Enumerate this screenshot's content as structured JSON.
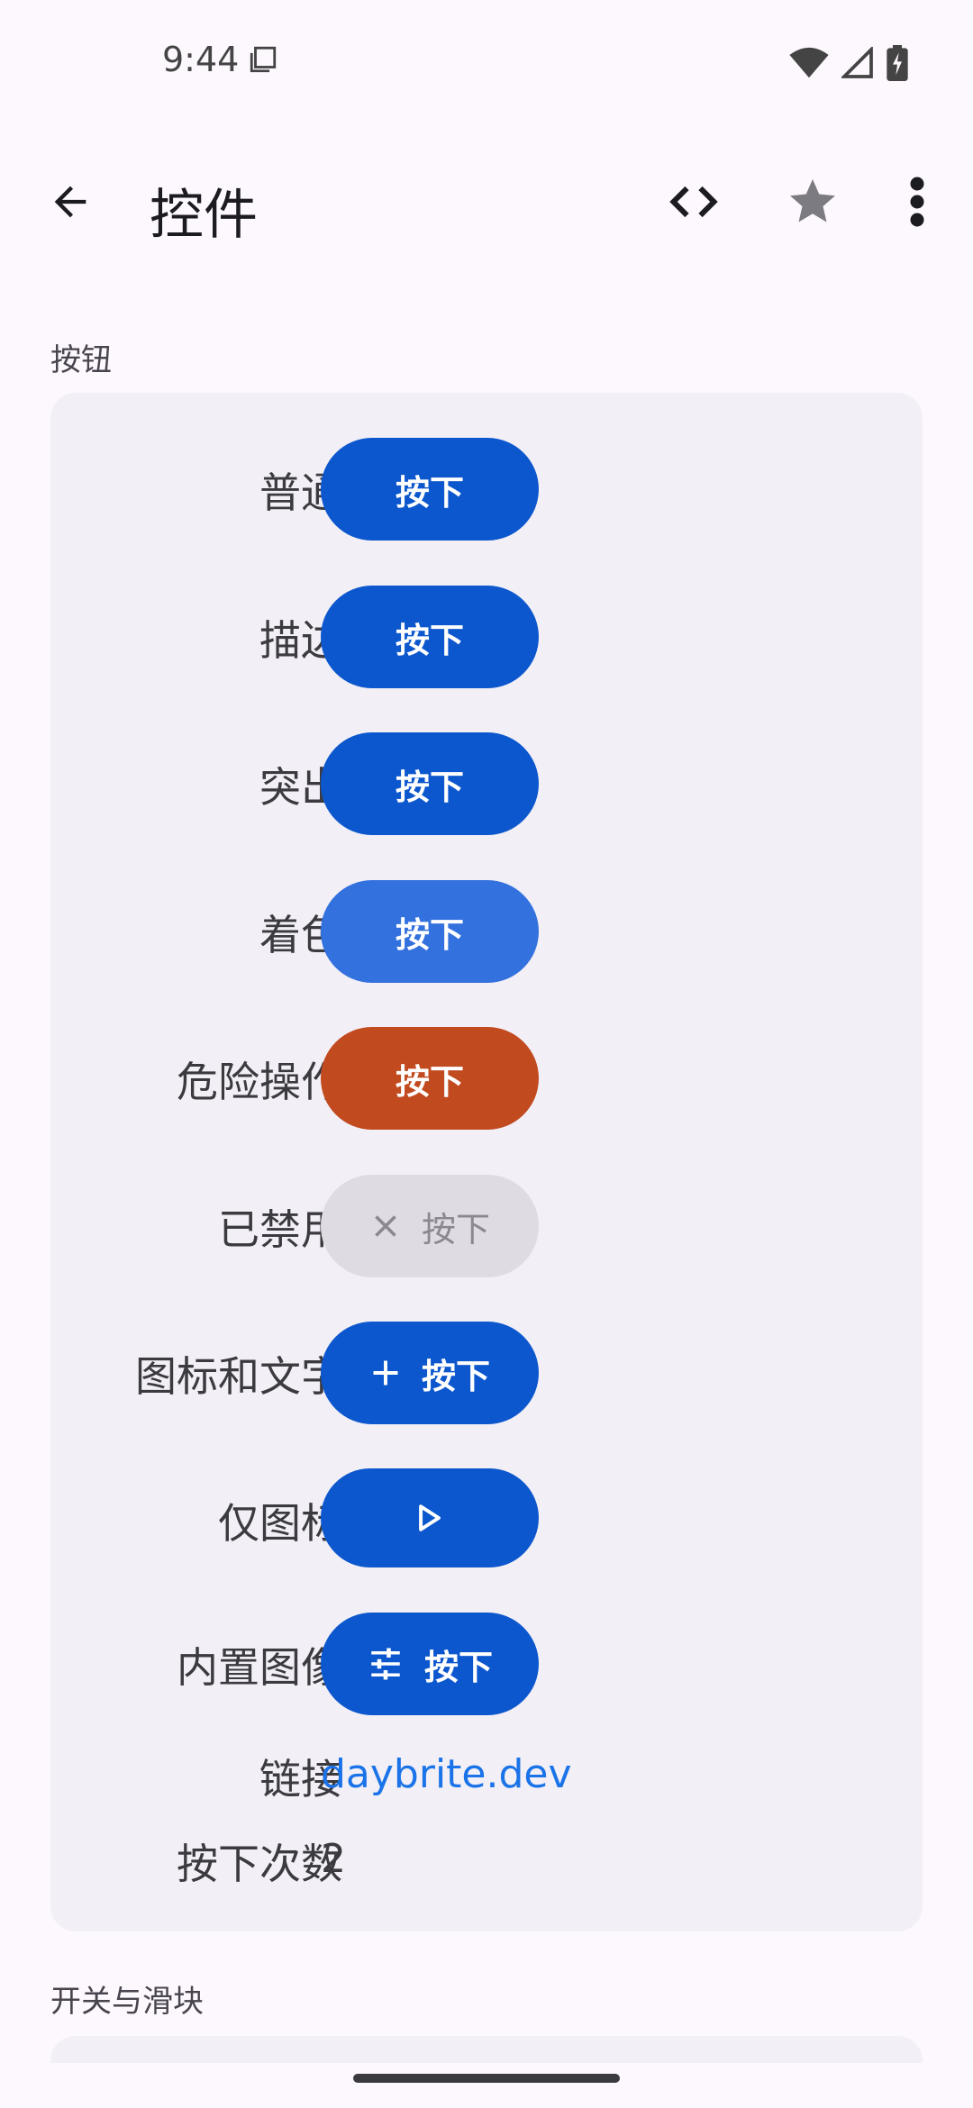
{
  "status_bar": {
    "time": "9:44"
  },
  "app_bar": {
    "title": "控件",
    "back_icon": "arrow-back-icon",
    "code_icon": "code-icon",
    "star_icon": "star-icon",
    "more_icon": "more-vert-icon"
  },
  "sections": {
    "buttons_title": "按钮",
    "switches_title": "开关与滑块"
  },
  "buttons": {
    "rows": [
      {
        "label": "普通",
        "button": "按下"
      },
      {
        "label": "描边",
        "button": "按下"
      },
      {
        "label": "突出",
        "button": "按下"
      },
      {
        "label": "着色",
        "button": "按下"
      },
      {
        "label": "危险操作",
        "button": "按下"
      },
      {
        "label": "已禁用",
        "button": "按下"
      },
      {
        "label": "图标和文字",
        "button": "按下"
      },
      {
        "label": "仅图标",
        "button": ""
      },
      {
        "label": "内置图像",
        "button": "按下"
      }
    ],
    "link_label": "链接",
    "link_value": "daybrite.dev",
    "count_label": "按下次数",
    "count_value": "2"
  },
  "colors": {
    "primary": "#0c57cd",
    "tonal": "#3371de",
    "danger": "#c14a1f",
    "disabled_bg": "#dedce2",
    "link": "#1a73e8"
  }
}
